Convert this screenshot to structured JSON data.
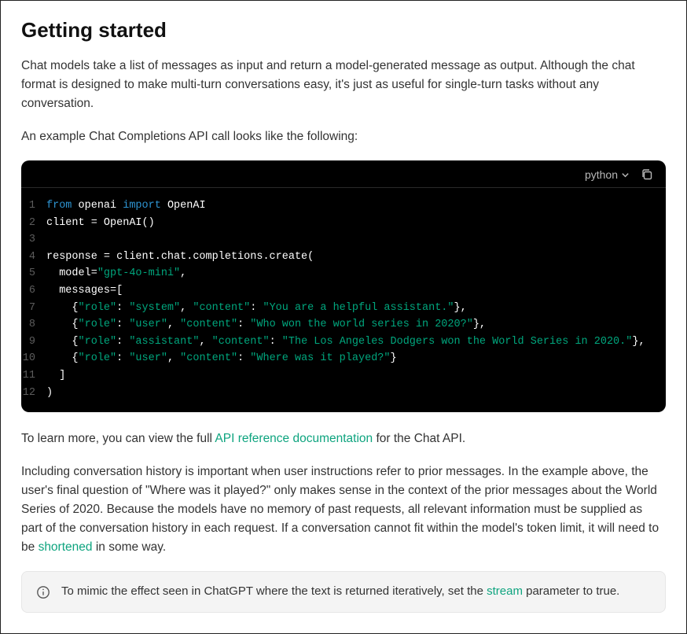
{
  "heading": "Getting started",
  "intro_paragraph": "Chat models take a list of messages as input and return a model-generated message as output. Although the chat format is designed to make multi-turn conversations easy, it's just as useful for single-turn tasks without any conversation.",
  "example_lead": "An example Chat Completions API call looks like the following:",
  "code_block": {
    "language": "python",
    "lines": [
      {
        "n": "1",
        "tokens": [
          {
            "t": "from ",
            "c": "kw"
          },
          {
            "t": "openai ",
            "c": "pl"
          },
          {
            "t": "import ",
            "c": "kw"
          },
          {
            "t": "OpenAI",
            "c": "pl"
          }
        ]
      },
      {
        "n": "2",
        "tokens": [
          {
            "t": "client = OpenAI()",
            "c": "pl"
          }
        ]
      },
      {
        "n": "3",
        "tokens": [
          {
            "t": "",
            "c": "pl"
          }
        ]
      },
      {
        "n": "4",
        "tokens": [
          {
            "t": "response = client.chat.completions.create(",
            "c": "pl"
          }
        ]
      },
      {
        "n": "5",
        "tokens": [
          {
            "t": "  model=",
            "c": "pl"
          },
          {
            "t": "\"gpt-4o-mini\"",
            "c": "str"
          },
          {
            "t": ",",
            "c": "pl"
          }
        ]
      },
      {
        "n": "6",
        "tokens": [
          {
            "t": "  messages=[",
            "c": "pl"
          }
        ]
      },
      {
        "n": "7",
        "tokens": [
          {
            "t": "    {",
            "c": "pl"
          },
          {
            "t": "\"role\"",
            "c": "str"
          },
          {
            "t": ": ",
            "c": "pl"
          },
          {
            "t": "\"system\"",
            "c": "str"
          },
          {
            "t": ", ",
            "c": "pl"
          },
          {
            "t": "\"content\"",
            "c": "str"
          },
          {
            "t": ": ",
            "c": "pl"
          },
          {
            "t": "\"You are a helpful assistant.\"",
            "c": "str"
          },
          {
            "t": "},",
            "c": "pl"
          }
        ]
      },
      {
        "n": "8",
        "tokens": [
          {
            "t": "    {",
            "c": "pl"
          },
          {
            "t": "\"role\"",
            "c": "str"
          },
          {
            "t": ": ",
            "c": "pl"
          },
          {
            "t": "\"user\"",
            "c": "str"
          },
          {
            "t": ", ",
            "c": "pl"
          },
          {
            "t": "\"content\"",
            "c": "str"
          },
          {
            "t": ": ",
            "c": "pl"
          },
          {
            "t": "\"Who won the world series in 2020?\"",
            "c": "str"
          },
          {
            "t": "},",
            "c": "pl"
          }
        ]
      },
      {
        "n": "9",
        "tokens": [
          {
            "t": "    {",
            "c": "pl"
          },
          {
            "t": "\"role\"",
            "c": "str"
          },
          {
            "t": ": ",
            "c": "pl"
          },
          {
            "t": "\"assistant\"",
            "c": "str"
          },
          {
            "t": ", ",
            "c": "pl"
          },
          {
            "t": "\"content\"",
            "c": "str"
          },
          {
            "t": ": ",
            "c": "pl"
          },
          {
            "t": "\"The Los Angeles Dodgers won the World Series in 2020.\"",
            "c": "str"
          },
          {
            "t": "},",
            "c": "pl"
          }
        ]
      },
      {
        "n": "10",
        "tokens": [
          {
            "t": "    {",
            "c": "pl"
          },
          {
            "t": "\"role\"",
            "c": "str"
          },
          {
            "t": ": ",
            "c": "pl"
          },
          {
            "t": "\"user\"",
            "c": "str"
          },
          {
            "t": ", ",
            "c": "pl"
          },
          {
            "t": "\"content\"",
            "c": "str"
          },
          {
            "t": ": ",
            "c": "pl"
          },
          {
            "t": "\"Where was it played?\"",
            "c": "str"
          },
          {
            "t": "}",
            "c": "pl"
          }
        ]
      },
      {
        "n": "11",
        "tokens": [
          {
            "t": "  ]",
            "c": "pl"
          }
        ]
      },
      {
        "n": "12",
        "tokens": [
          {
            "t": ")",
            "c": "pl"
          }
        ]
      }
    ]
  },
  "learn_more": {
    "prefix": "To learn more, you can view the full ",
    "link_text": "API reference documentation",
    "suffix": " for the Chat API."
  },
  "history_paragraph": {
    "prefix": "Including conversation history is important when user instructions refer to prior messages. In the example above, the user's final question of \"Where was it played?\" only makes sense in the context of the prior messages about the World Series of 2020. Because the models have no memory of past requests, all relevant information must be supplied as part of the conversation history in each request. If a conversation cannot fit within the model's token limit, it will need to be ",
    "link_text": "shortened",
    "suffix": " in some way."
  },
  "info_box": {
    "prefix": "To mimic the effect seen in ChatGPT where the text is returned iteratively, set the ",
    "link_text": "stream",
    "suffix": " parameter to true."
  }
}
